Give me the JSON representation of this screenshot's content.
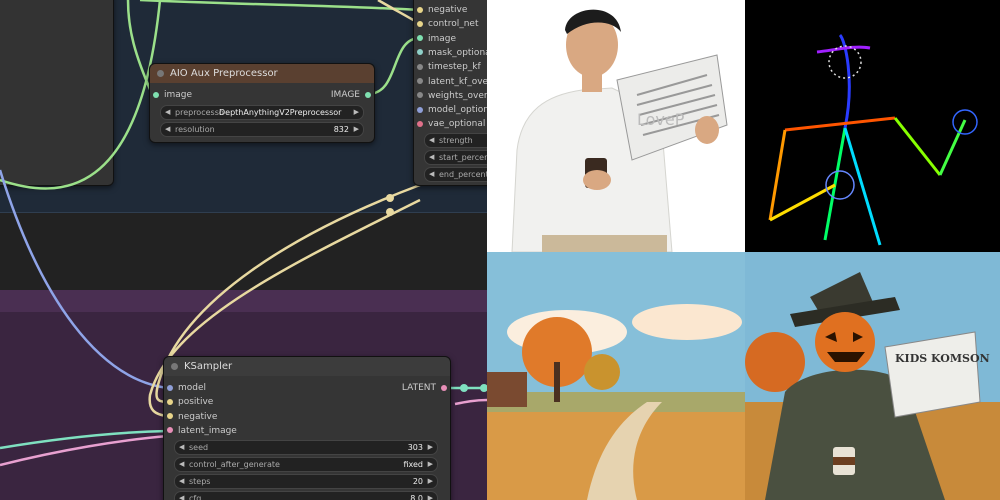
{
  "apply_node": {
    "inputs": [
      {
        "label": "negative",
        "color": "#e8d58a"
      },
      {
        "label": "control_net",
        "color": "#e8d58a"
      },
      {
        "label": "image",
        "color": "#7fe0b0"
      },
      {
        "label": "mask_optional",
        "color": "#8fd0c8"
      },
      {
        "label": "timestep_kf",
        "color": "#888888"
      },
      {
        "label": "latent_kf_overrid",
        "color": "#888888"
      },
      {
        "label": "weights_overrid",
        "color": "#888888"
      },
      {
        "label": "model_optional",
        "color": "#8f9fd8"
      },
      {
        "label": "vae_optional",
        "color": "#e0708a"
      }
    ],
    "widgets": [
      {
        "label": "strength"
      },
      {
        "label": "start_percent"
      },
      {
        "label": "end_percent"
      }
    ]
  },
  "aux_node": {
    "title": "AIO Aux Preprocessor",
    "title_color": "#5a4030",
    "input": {
      "label": "image",
      "color": "#7fe0b0"
    },
    "output": {
      "label": "IMAGE",
      "color": "#7fe0b0"
    },
    "widgets": [
      {
        "label": "preprocesso",
        "value": "DepthAnythingV2Preprocessor"
      },
      {
        "label": "resolution",
        "value": "832"
      }
    ]
  },
  "ksampler": {
    "title": "KSampler",
    "inputs": [
      {
        "label": "model",
        "color": "#8f9fd8"
      },
      {
        "label": "positive",
        "color": "#e8d58a"
      },
      {
        "label": "negative",
        "color": "#e8d58a"
      },
      {
        "label": "latent_image",
        "color": "#e88fb8"
      }
    ],
    "output": {
      "label": "LATENT",
      "color": "#e88fb8"
    },
    "widgets": [
      {
        "label": "seed",
        "value": "303"
      },
      {
        "label": "control_after_generate",
        "value": "fixed"
      },
      {
        "label": "steps",
        "value": "20"
      },
      {
        "label": "cfg",
        "value": "8.0"
      }
    ]
  },
  "images": [
    {
      "name": "man-reading-newspaper",
      "watermark": "LoveP"
    },
    {
      "name": "openpose-skeleton"
    },
    {
      "name": "autumn-road-landscape"
    },
    {
      "name": "pumpkin-scarecrow-newspaper",
      "sign": "KIDS KOMSON"
    }
  ],
  "colors": {
    "wire_green": "#9be08a",
    "wire_yellow": "#e8d9a0",
    "wire_blue": "#8fa4e8",
    "wire_teal": "#7fe0c0",
    "wire_pink": "#e8a0d0"
  }
}
